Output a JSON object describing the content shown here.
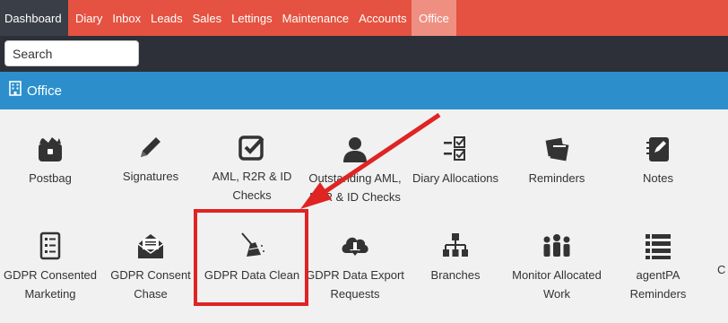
{
  "nav": {
    "items": [
      "Dashboard",
      "Diary",
      "Inbox",
      "Leads",
      "Sales",
      "Lettings",
      "Maintenance",
      "Accounts",
      "Office"
    ],
    "active": "Office"
  },
  "search": {
    "placeholder": "Search"
  },
  "section": {
    "icon": "building-icon",
    "title": "Office"
  },
  "tiles": [
    {
      "label": "Postbag",
      "icon": "postbag-icon"
    },
    {
      "label": "Signatures",
      "icon": "pencil-icon"
    },
    {
      "label": "AML, R2R & ID Checks",
      "icon": "check-square-icon"
    },
    {
      "label": "Outstanding AML, R2R & ID Checks",
      "icon": "user-icon"
    },
    {
      "label": "Diary Allocations",
      "icon": "list-check-icon"
    },
    {
      "label": "Reminders",
      "icon": "sticky-notes-icon"
    },
    {
      "label": "Notes",
      "icon": "notes-icon"
    },
    {
      "label": "GDPR Consented Marketing",
      "icon": "checklist-icon"
    },
    {
      "label": "GDPR Consent Chase",
      "icon": "envelope-open-icon"
    },
    {
      "label": "GDPR Data Clean",
      "icon": "broom-icon"
    },
    {
      "label": "GDPR Data Export Requests",
      "icon": "cloud-download-icon"
    },
    {
      "label": "Branches",
      "icon": "sitemap-icon"
    },
    {
      "label": "Monitor Allocated Work",
      "icon": "users-icon"
    },
    {
      "label": "agentPA Reminders",
      "icon": "list-icon"
    }
  ],
  "annotation": {
    "highlighted_tile": "GDPR Data Clean",
    "color": "#e02323"
  }
}
